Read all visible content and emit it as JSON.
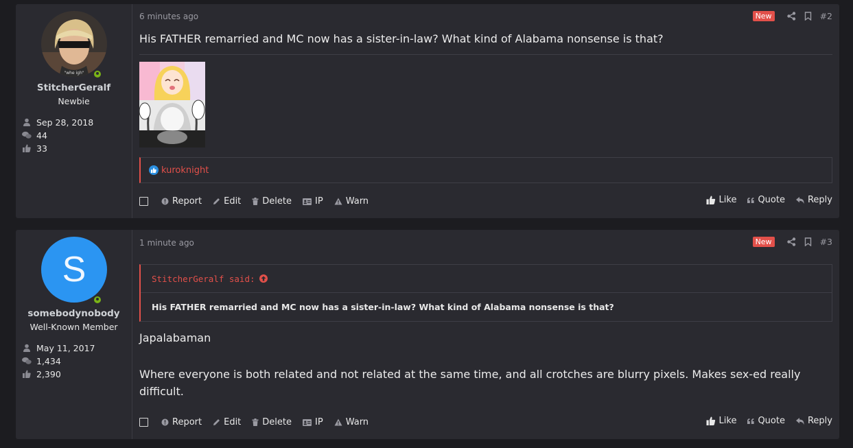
{
  "posts": [
    {
      "user": {
        "name": "StitcherGeralf",
        "title": "Newbie",
        "joined": "Sep 28, 2018",
        "messages": "44",
        "reactions": "33",
        "avatar_icon": "anime-character-avatar"
      },
      "date": "6 minutes ago",
      "badge": "New",
      "number": "#2",
      "text": "His FATHER remarried and MC now has a sister-in-law? What kind of Alabama nonsense is that?",
      "reaction_user": "kuroknight",
      "actions": {
        "report": "Report",
        "edit": "Edit",
        "delete": "Delete",
        "ip": "IP",
        "warn": "Warn",
        "like": "Like",
        "quote": "Quote",
        "reply": "Reply"
      }
    },
    {
      "user": {
        "name": "somebodynobody",
        "title": "Well-Known Member",
        "joined": "May 11, 2017",
        "messages": "1,434",
        "reactions": "2,390",
        "avatar_letter": "S",
        "avatar_color": "#2b95f2"
      },
      "date": "1 minute ago",
      "badge": "New",
      "number": "#3",
      "quote": {
        "author": "StitcherGeralf said:",
        "text": "His FATHER remarried and MC now has a sister-in-law? What kind of Alabama nonsense is that?"
      },
      "text1": "Japalabaman",
      "text2": "Where everyone is both related and not related at the same time, and all crotches are blurry pixels. Makes sex-ed really difficult.",
      "actions": {
        "report": "Report",
        "edit": "Edit",
        "delete": "Delete",
        "ip": "IP",
        "warn": "Warn",
        "like": "Like",
        "quote": "Quote",
        "reply": "Reply"
      }
    }
  ],
  "colors": {
    "accent": "#e2504a",
    "online": "#7ab317",
    "like": "#2b8fe0"
  }
}
